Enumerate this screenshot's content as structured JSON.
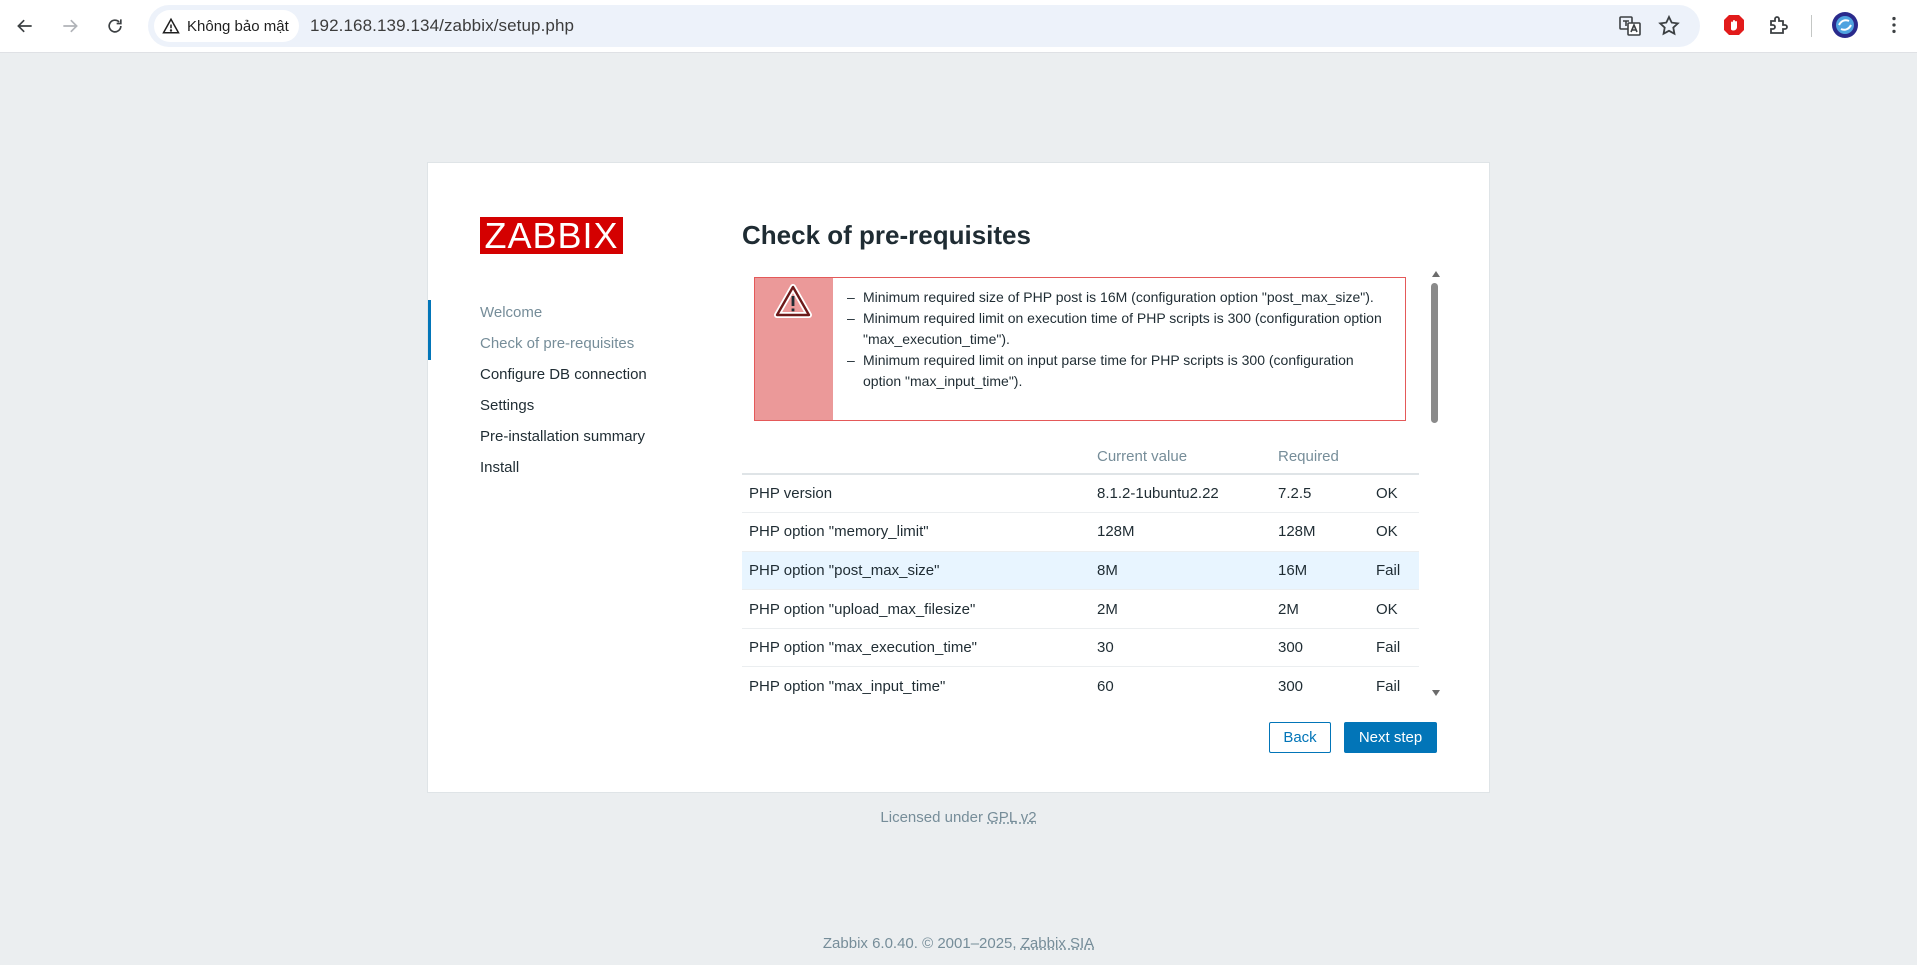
{
  "browser": {
    "security_label": "Không bảo mật",
    "url": "192.168.139.134/zabbix/setup.php"
  },
  "setup": {
    "logo_text": "ZABBIX",
    "steps": [
      {
        "label": "Welcome"
      },
      {
        "label": "Check of pre-requisites"
      },
      {
        "label": "Configure DB connection"
      },
      {
        "label": "Settings"
      },
      {
        "label": "Pre-installation summary"
      },
      {
        "label": "Install"
      }
    ],
    "title": "Check of pre-requisites",
    "messages": [
      "Minimum required size of PHP post is 16M (configuration option \"post_max_size\").",
      "Minimum required limit on execution time of PHP scripts is 300 (configuration option \"max_execution_time\").",
      "Minimum required limit on input parse time for PHP scripts is 300 (configuration option \"max_input_time\")."
    ],
    "table": {
      "headers": [
        "",
        "Current value",
        "Required",
        ""
      ],
      "rows": [
        {
          "name": "PHP version",
          "current": "8.1.2-1ubuntu2.22",
          "required": "7.2.5",
          "status": "OK"
        },
        {
          "name": "PHP option \"memory_limit\"",
          "current": "128M",
          "required": "128M",
          "status": "OK"
        },
        {
          "name": "PHP option \"post_max_size\"",
          "current": "8M",
          "required": "16M",
          "status": "Fail"
        },
        {
          "name": "PHP option \"upload_max_filesize\"",
          "current": "2M",
          "required": "2M",
          "status": "OK"
        },
        {
          "name": "PHP option \"max_execution_time\"",
          "current": "30",
          "required": "300",
          "status": "Fail"
        },
        {
          "name": "PHP option \"max_input_time\"",
          "current": "60",
          "required": "300",
          "status": "Fail"
        }
      ]
    },
    "buttons": {
      "back": "Back",
      "next": "Next step"
    }
  },
  "license": {
    "prefix": "Licensed under ",
    "link": "GPL v2"
  },
  "footer": {
    "prefix": "Zabbix 6.0.40. © 2001–2025, ",
    "link": "Zabbix SIA"
  },
  "colors": {
    "brand": "#d40000",
    "accent": "#0275b8",
    "ok": "#429e47",
    "fail": "#e45959"
  }
}
